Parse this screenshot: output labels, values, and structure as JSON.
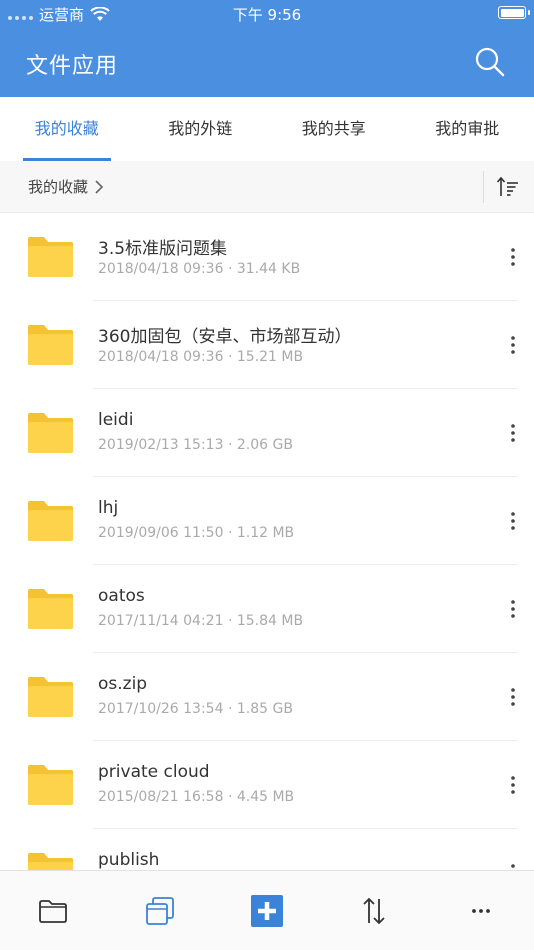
{
  "status_bar": {
    "carrier": "运营商",
    "time": "下午 9:56"
  },
  "nav": {
    "title": "文件应用"
  },
  "tabs": [
    {
      "label": "我的收藏",
      "active": true
    },
    {
      "label": "我的外链",
      "active": false
    },
    {
      "label": "我的共享",
      "active": false
    },
    {
      "label": "我的审批",
      "active": false
    }
  ],
  "breadcrumb": {
    "label": "我的收藏"
  },
  "files": [
    {
      "name": "3.5标准版问题集",
      "date": "2018/04/18 09:36",
      "size": "31.44 KB"
    },
    {
      "name": "360加固包（安卓、市场部互动）",
      "date": "2018/04/18 09:36",
      "size": "15.21 MB"
    },
    {
      "name": "leidi",
      "date": "2019/02/13 15:13",
      "size": "2.06 GB"
    },
    {
      "name": "lhj",
      "date": "2019/09/06 11:50",
      "size": "1.12 MB"
    },
    {
      "name": "oatos",
      "date": "2017/11/14 04:21",
      "size": "15.84 MB"
    },
    {
      "name": "os.zip",
      "date": "2017/10/26 13:54",
      "size": "1.85 GB"
    },
    {
      "name": "private cloud",
      "date": "2015/08/21 16:58",
      "size": "4.45 MB"
    },
    {
      "name": "publish",
      "date": "",
      "size": ""
    }
  ],
  "meta_separator": " · ",
  "colors": {
    "header_bg": "#4a8fe0",
    "accent": "#3b83d8",
    "folder": "#fcd34a"
  },
  "toolbar_icons": [
    "folder-icon",
    "copy-icon",
    "add-icon",
    "transfer-icon",
    "more-icon"
  ]
}
